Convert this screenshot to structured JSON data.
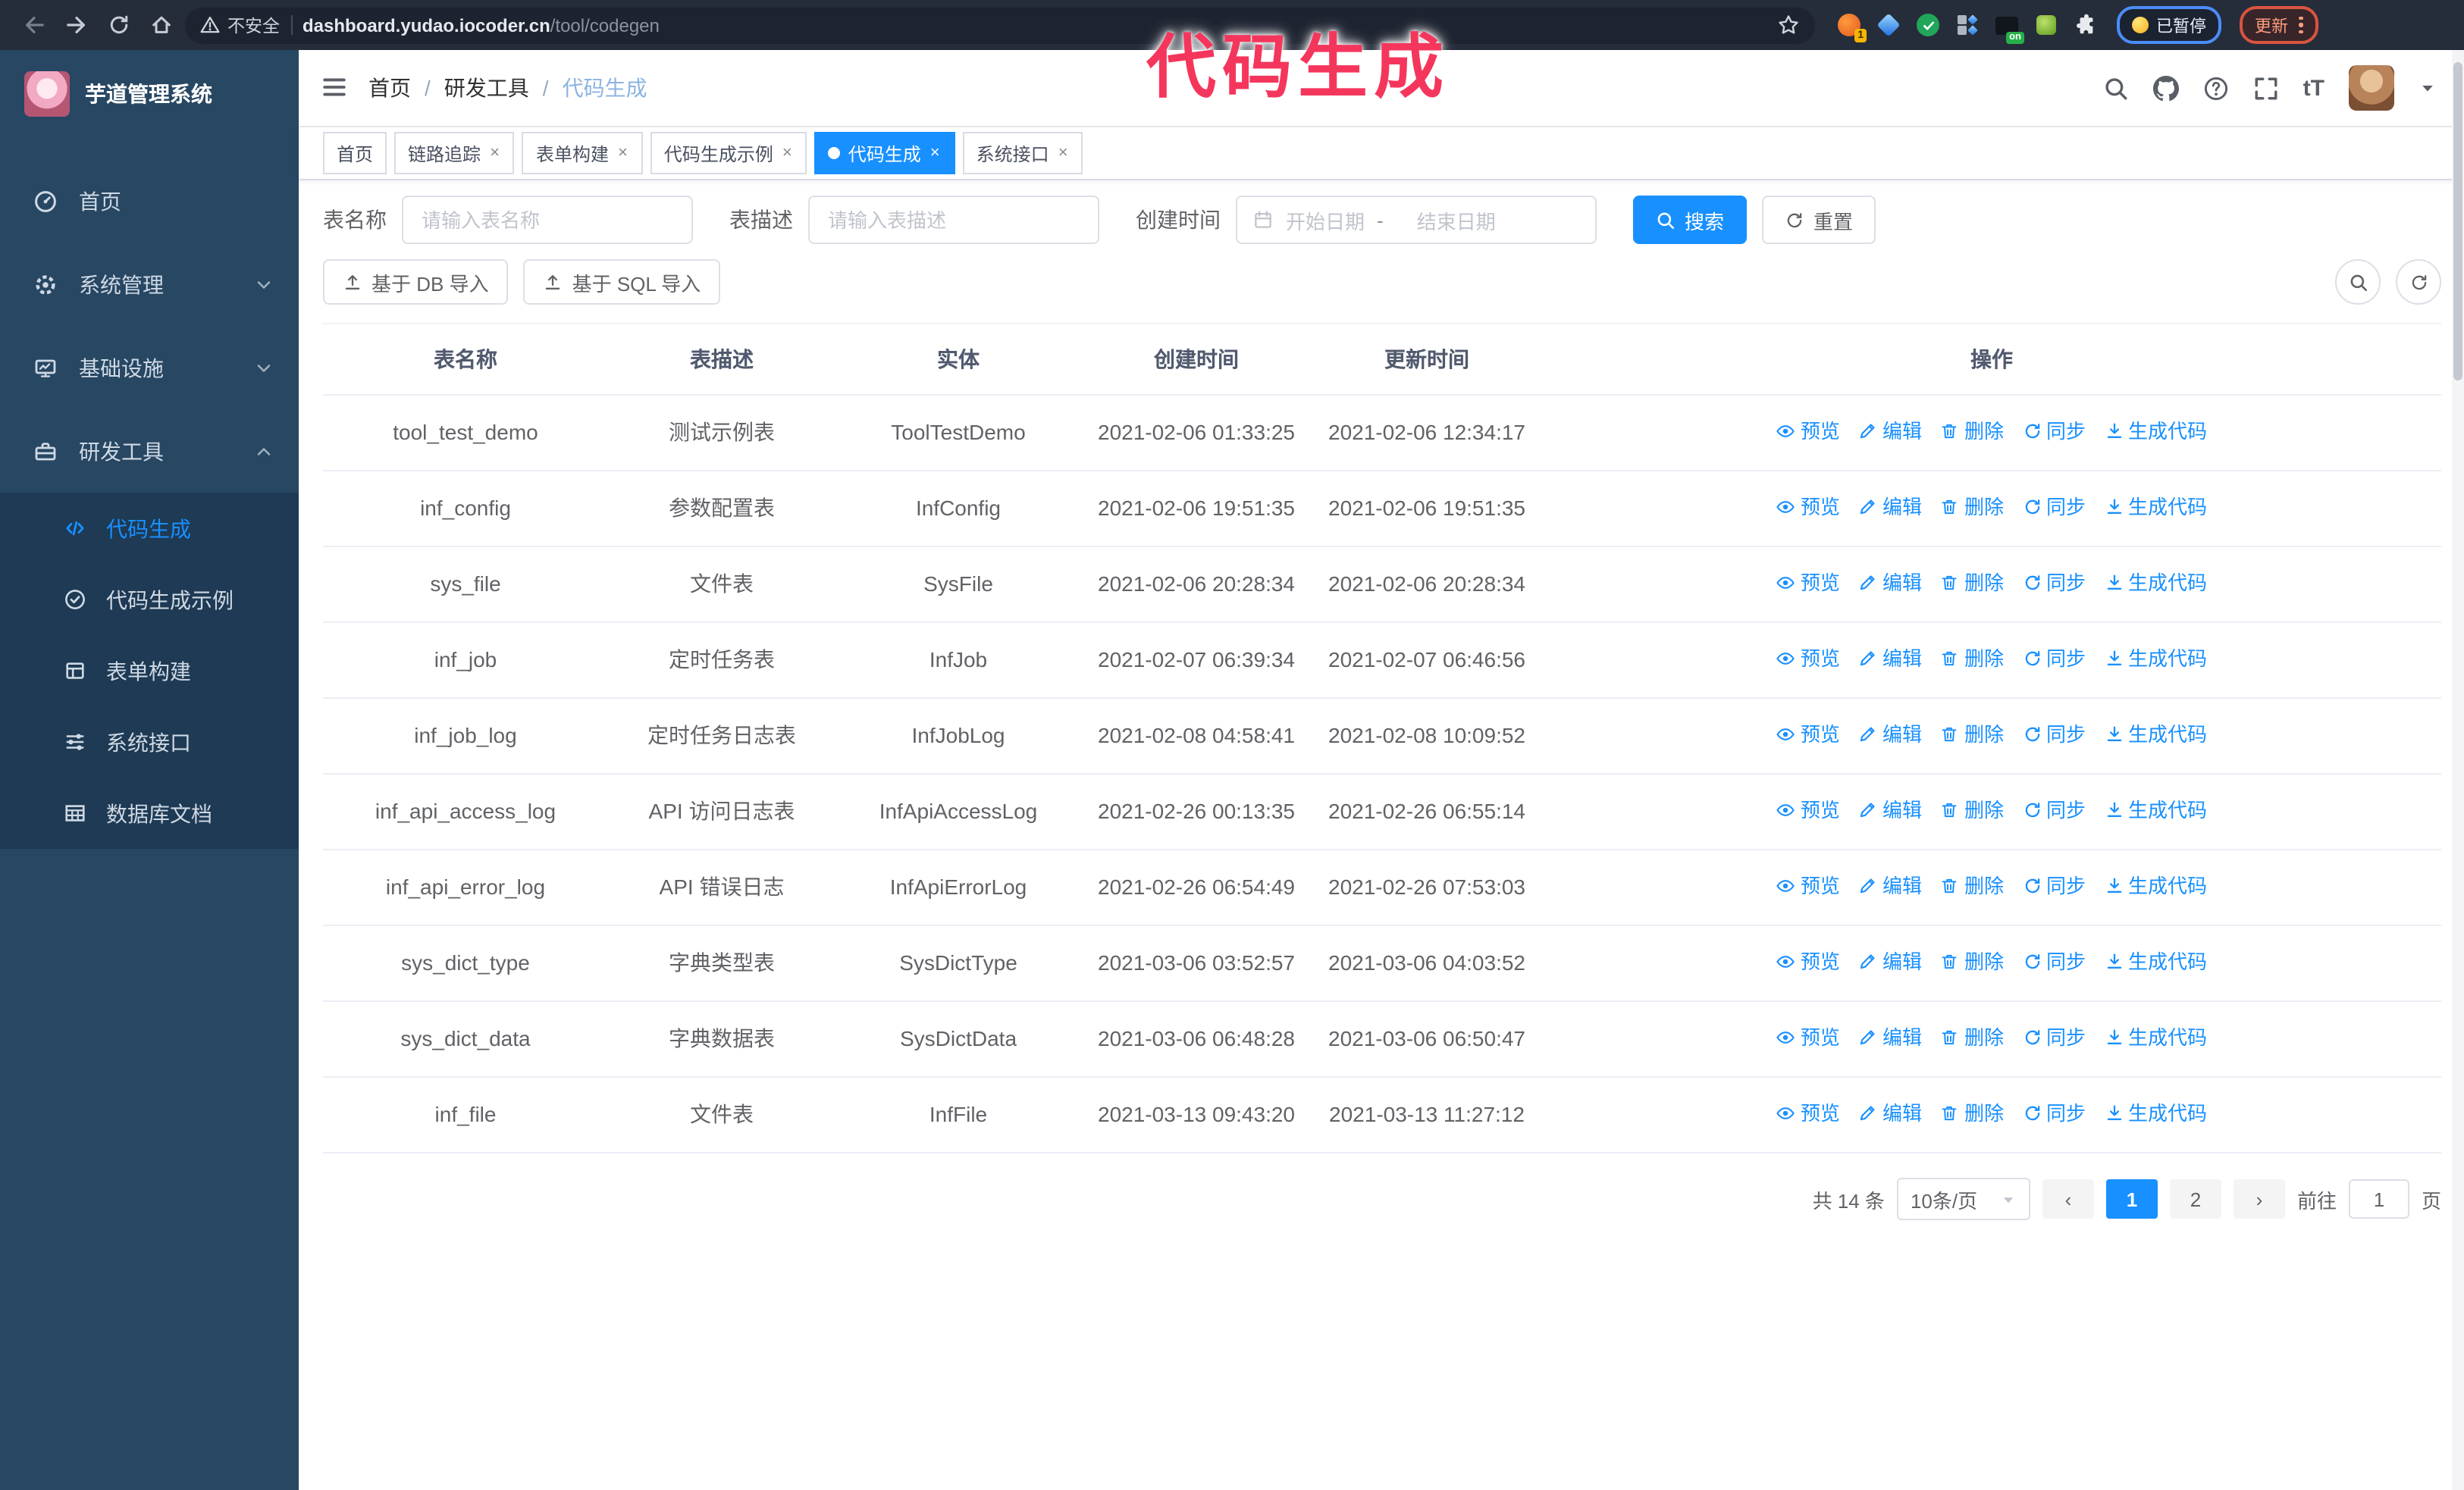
{
  "annotation": {
    "text": "代码生成"
  },
  "browser": {
    "security_label": "不安全",
    "url_host": "dashboard.yudao.iocoder.cn",
    "url_path": "/tool/codegen",
    "ext_badge": "1",
    "ext_on": "on",
    "paused_label": "已暂停",
    "update_label": "更新"
  },
  "sidebar": {
    "title": "芋道管理系统",
    "menu": [
      {
        "label": "首页"
      },
      {
        "label": "系统管理"
      },
      {
        "label": "基础设施"
      },
      {
        "label": "研发工具"
      }
    ],
    "submenu": [
      {
        "label": "代码生成"
      },
      {
        "label": "代码生成示例"
      },
      {
        "label": "表单构建"
      },
      {
        "label": "系统接口"
      },
      {
        "label": "数据库文档"
      }
    ]
  },
  "breadcrumb": {
    "items": [
      "首页",
      "研发工具",
      "代码生成"
    ]
  },
  "tabs": [
    {
      "label": "首页"
    },
    {
      "label": "链路追踪"
    },
    {
      "label": "表单构建"
    },
    {
      "label": "代码生成示例"
    },
    {
      "label": "代码生成"
    },
    {
      "label": "系统接口"
    }
  ],
  "search": {
    "name_label": "表名称",
    "name_placeholder": "请输入表名称",
    "desc_label": "表描述",
    "desc_placeholder": "请输入表描述",
    "time_label": "创建时间",
    "start_placeholder": "开始日期",
    "range_separator": "-",
    "end_placeholder": "结束日期",
    "search_label": "搜索",
    "reset_label": "重置"
  },
  "toolbar": {
    "db_import_label": "基于 DB 导入",
    "sql_import_label": "基于 SQL 导入"
  },
  "table": {
    "columns": [
      "表名称",
      "表描述",
      "实体",
      "创建时间",
      "更新时间",
      "操作"
    ],
    "actions": [
      "预览",
      "编辑",
      "删除",
      "同步",
      "生成代码"
    ],
    "rows": [
      {
        "name": "tool_test_demo",
        "desc": "测试示例表",
        "entity": "ToolTestDemo",
        "created": "2021-02-06 01:33:25",
        "updated": "2021-02-06 12:34:17"
      },
      {
        "name": "inf_config",
        "desc": "参数配置表",
        "entity": "InfConfig",
        "created": "2021-02-06 19:51:35",
        "updated": "2021-02-06 19:51:35"
      },
      {
        "name": "sys_file",
        "desc": "文件表",
        "entity": "SysFile",
        "created": "2021-02-06 20:28:34",
        "updated": "2021-02-06 20:28:34"
      },
      {
        "name": "inf_job",
        "desc": "定时任务表",
        "entity": "InfJob",
        "created": "2021-02-07 06:39:34",
        "updated": "2021-02-07 06:46:56"
      },
      {
        "name": "inf_job_log",
        "desc": "定时任务日志表",
        "entity": "InfJobLog",
        "created": "2021-02-08 04:58:41",
        "updated": "2021-02-08 10:09:52"
      },
      {
        "name": "inf_api_access_log",
        "desc": "API 访问日志表",
        "entity": "InfApiAccessLog",
        "created": "2021-02-26 00:13:35",
        "updated": "2021-02-26 06:55:14"
      },
      {
        "name": "inf_api_error_log",
        "desc": "API 错误日志",
        "entity": "InfApiErrorLog",
        "created": "2021-02-26 06:54:49",
        "updated": "2021-02-26 07:53:03"
      },
      {
        "name": "sys_dict_type",
        "desc": "字典类型表",
        "entity": "SysDictType",
        "created": "2021-03-06 03:52:57",
        "updated": "2021-03-06 04:03:52"
      },
      {
        "name": "sys_dict_data",
        "desc": "字典数据表",
        "entity": "SysDictData",
        "created": "2021-03-06 06:48:28",
        "updated": "2021-03-06 06:50:47"
      },
      {
        "name": "inf_file",
        "desc": "文件表",
        "entity": "InfFile",
        "created": "2021-03-13 09:43:20",
        "updated": "2021-03-13 11:27:12"
      }
    ]
  },
  "pagination": {
    "total": "共 14 条",
    "page_size": "10条/页",
    "pages": [
      "1",
      "2"
    ],
    "goto_label": "前往",
    "goto_value": "1",
    "goto_suffix": "页"
  },
  "colors": {
    "primary": "#1890ff",
    "annotation_pink": "#f5365c",
    "sidebar_bg": "#274763",
    "submenu_bg": "#1e3a54",
    "chrome_bg": "#252c3a"
  }
}
